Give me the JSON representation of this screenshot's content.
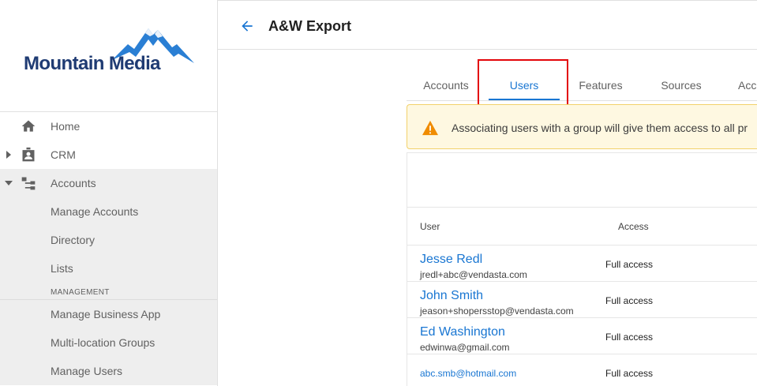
{
  "app": {
    "brand_name": "Mountain Media",
    "brand_color": "#1f3b73",
    "accent_color": "#1976d2"
  },
  "sidebar": {
    "items": [
      {
        "label": "Home",
        "icon": "home-icon"
      },
      {
        "label": "CRM",
        "icon": "contact-card-icon"
      },
      {
        "label": "Accounts",
        "icon": "hierarchy-icon"
      }
    ],
    "accounts_sub": [
      "Manage Accounts",
      "Directory",
      "Lists"
    ],
    "section_label": "MANAGEMENT",
    "management_sub": [
      "Manage Business App",
      "Multi-location Groups",
      "Manage Users"
    ]
  },
  "header": {
    "title": "A&W Export"
  },
  "tabs": [
    {
      "label": "Accounts"
    },
    {
      "label": "Users",
      "active": true
    },
    {
      "label": "Features"
    },
    {
      "label": "Sources"
    },
    {
      "label": "Acc"
    }
  ],
  "banner": {
    "text": "Associating users with a group will give them access to all pr",
    "icon": "warning-icon"
  },
  "table": {
    "headers": {
      "user": "User",
      "access": "Access"
    },
    "rows": [
      {
        "name": "Jesse Redl",
        "email": "jredl+abc@vendasta.com",
        "access": "Full access"
      },
      {
        "name": "John Smith",
        "email": "jeason+shopersstop@vendasta.com",
        "access": "Full access"
      },
      {
        "name": "Ed Washington",
        "email": "edwinwa@gmail.com",
        "access": "Full access"
      },
      {
        "name": "",
        "email": "abc.smb@hotmail.com",
        "access": "Full access"
      }
    ]
  }
}
